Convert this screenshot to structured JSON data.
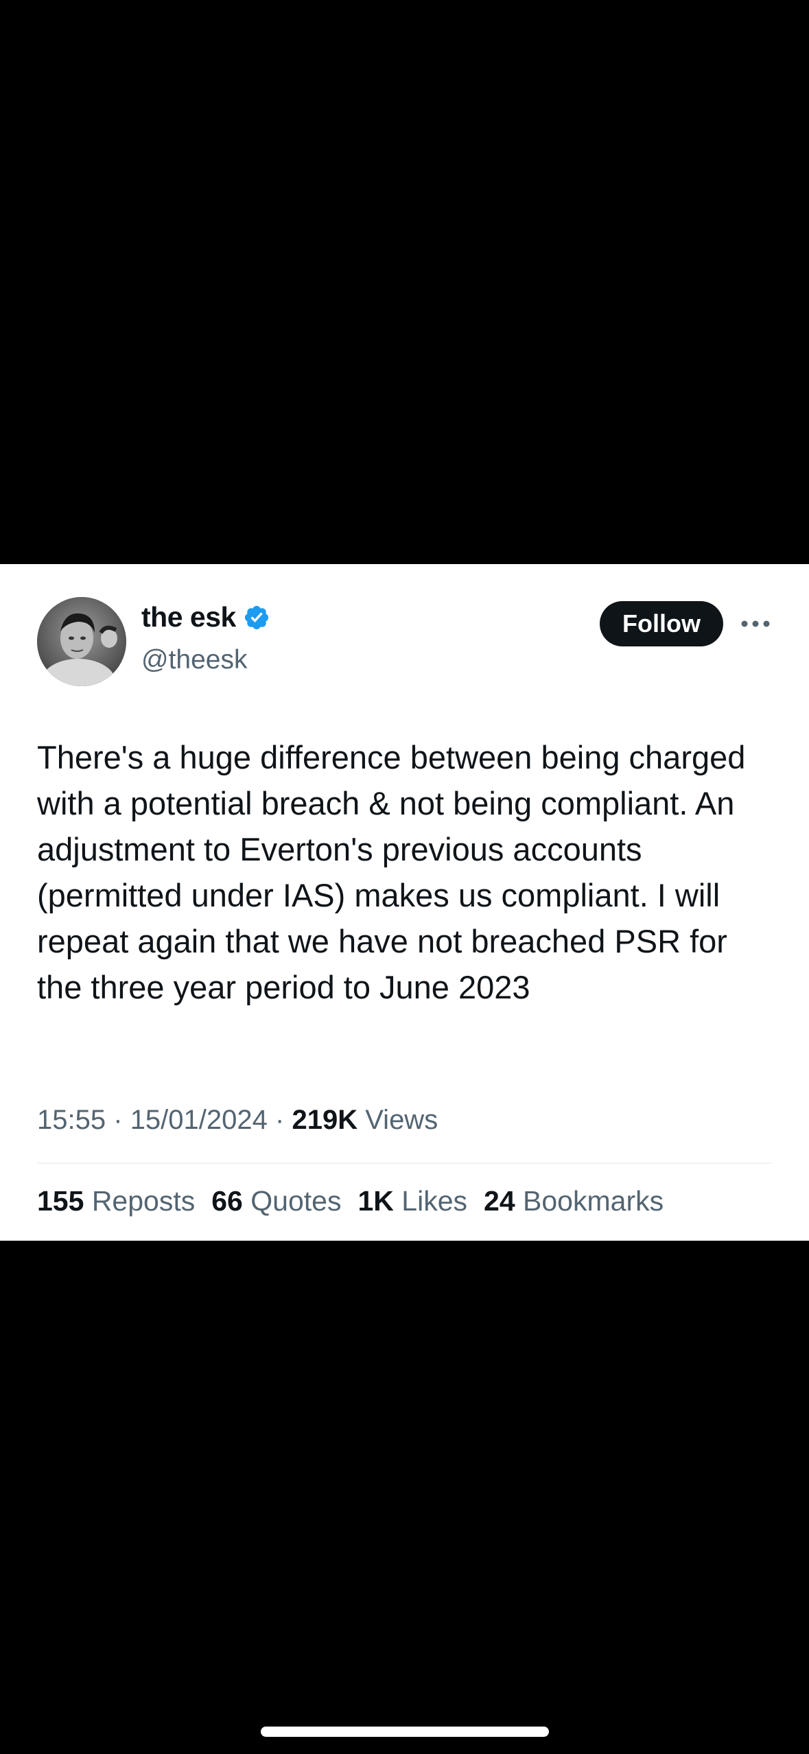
{
  "tweet": {
    "author": {
      "display_name": "the esk",
      "handle": "@theesk",
      "verified_icon": "verified-badge-icon",
      "verified_color": "#1d9bf0"
    },
    "follow_label": "Follow",
    "more_icon": "more-horizontal-icon",
    "text": "There's a huge difference between being charged with a potential breach & not being compliant. An adjustment to Everton's previous accounts (permitted under IAS) makes us compliant. I will repeat again that we have not breached PSR for the three year period to June 2023",
    "time": "15:55",
    "date": "15/01/2024",
    "separator": "·",
    "views_count": "219K",
    "views_label": "Views",
    "stats": [
      {
        "count": "155",
        "label": "Reposts"
      },
      {
        "count": "66",
        "label": "Quotes"
      },
      {
        "count": "1K",
        "label": "Likes"
      },
      {
        "count": "24",
        "label": "Bookmarks"
      }
    ]
  },
  "colors": {
    "background": "#000000",
    "card": "#ffffff",
    "text_primary": "#0f1419",
    "text_secondary": "#536471",
    "follow_button": "#0f1419"
  }
}
